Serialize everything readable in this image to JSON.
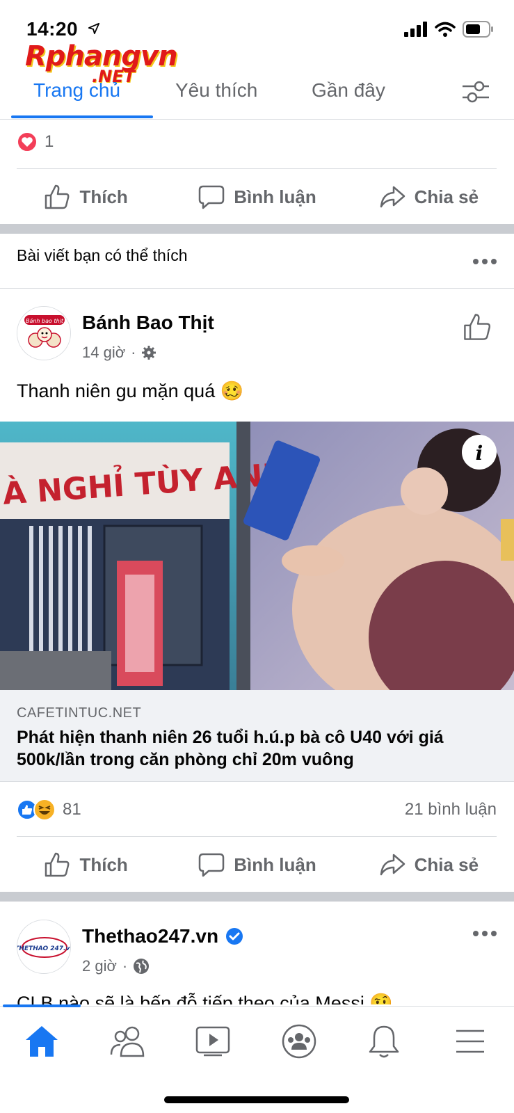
{
  "status_bar": {
    "time": "14:20"
  },
  "watermark": {
    "main": "Rphangvn",
    "sub": ".NET"
  },
  "top_tabs": [
    {
      "label": "Trang chủ",
      "active": true
    },
    {
      "label": "Yêu thích",
      "active": false
    },
    {
      "label": "Gần đây",
      "active": false
    }
  ],
  "prev_post": {
    "reaction_count": "1",
    "actions": {
      "like": "Thích",
      "comment": "Bình luận",
      "share": "Chia sẻ"
    }
  },
  "suggestion_header": "Bài viết bạn có thể thích",
  "post1": {
    "page_name": "Bánh Bao Thịt",
    "avatar_text": "Bánh bao thịt",
    "time": "14 giờ",
    "privacy_icon": "gear-icon",
    "text": "Thanh niên gu mặn quá 🥴",
    "image_sign": "À NGHỈ TÙY ANH",
    "link_domain": "CAFETINTUC.NET",
    "link_title": "Phát hiện thanh niên 26 tuổi h.ú.p bà cô U40 với giá 500k/lần trong căn phòng chỉ 20m vuông",
    "reaction_count": "81",
    "comment_count": "21 bình luận",
    "actions": {
      "like": "Thích",
      "comment": "Bình luận",
      "share": "Chia sẻ"
    }
  },
  "post2": {
    "page_name": "Thethao247.vn",
    "avatar_text": "THETHAO 247.vn",
    "time": "2 giờ",
    "privacy_icon": "globe-icon",
    "text_partial": "CLB nào sẽ là bến đỗ tiếp theo của Messi 🤨"
  },
  "colors": {
    "accent": "#1877f2",
    "secondary_text": "#65676b",
    "divider": "#dadde1",
    "love": "#f33e58"
  }
}
